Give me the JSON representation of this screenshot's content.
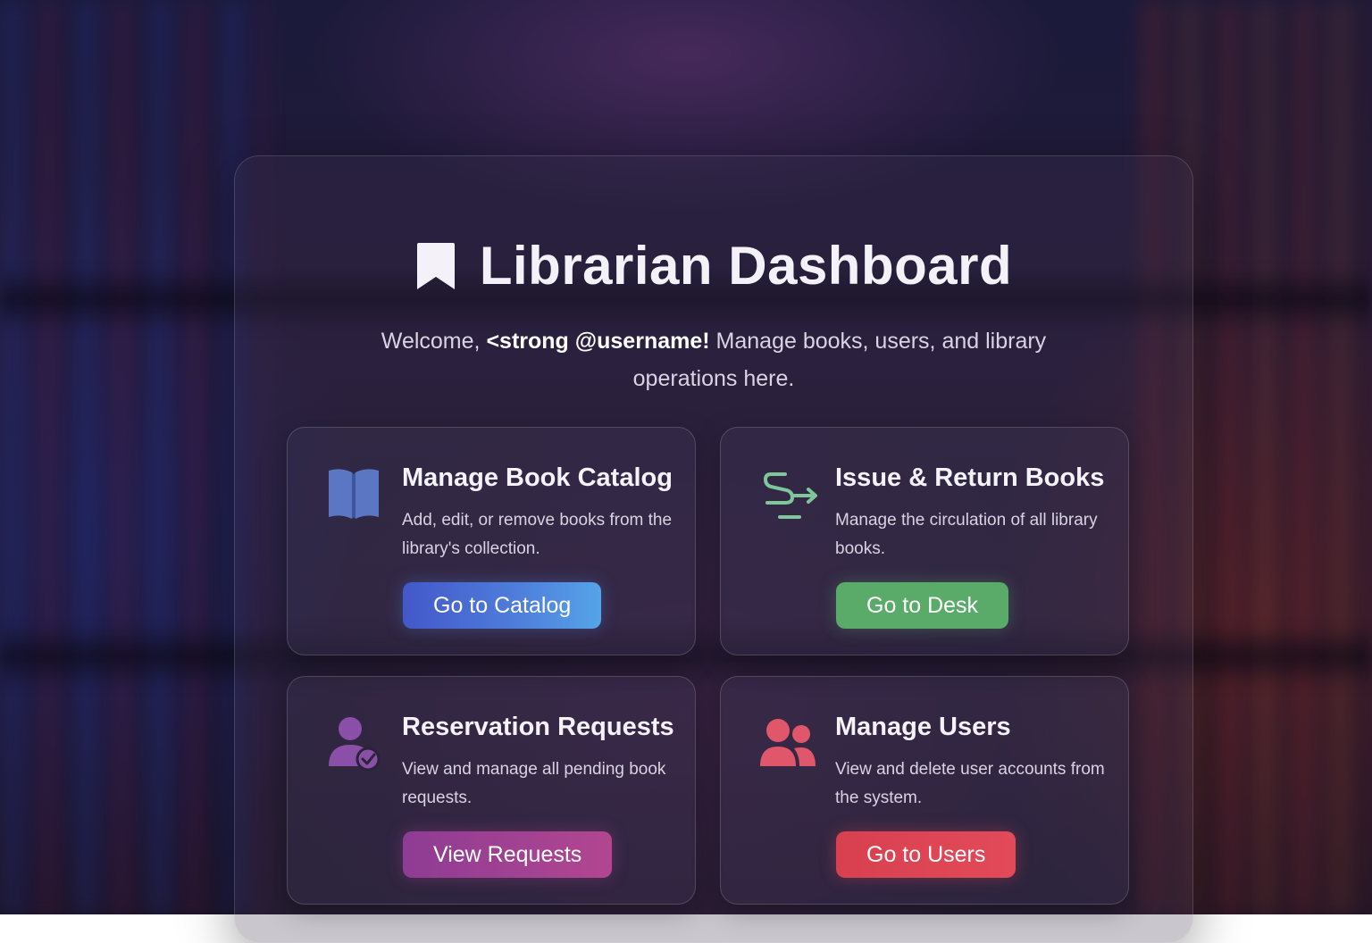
{
  "header": {
    "title": "Librarian Dashboard",
    "title_icon": "bookmark-icon",
    "welcome_prefix": "Welcome,",
    "welcome_user": "<strong @username!",
    "welcome_suffix": "Manage books, users, and library operations here."
  },
  "cards": [
    {
      "title": "Manage Book Catalog",
      "description": "Add, edit, or remove books from the library's collection.",
      "button_label": "Go to Catalog",
      "icon": "open-book-icon",
      "accent": "#4a64cc"
    },
    {
      "title": "Issue & Return Books",
      "description": "Manage the circulation of all library books.",
      "button_label": "Go to Desk",
      "icon": "circulation-arrows-icon",
      "accent": "#5aaa6a"
    },
    {
      "title": "Reservation Requests",
      "description": "View and manage all pending book requests.",
      "button_label": "View Requests",
      "icon": "user-check-icon",
      "accent": "#9b45a0"
    },
    {
      "title": "Manage Users",
      "description": "View and delete user accounts from the system.",
      "button_label": "Go to Users",
      "icon": "users-icon",
      "accent": "#e0485a"
    }
  ]
}
